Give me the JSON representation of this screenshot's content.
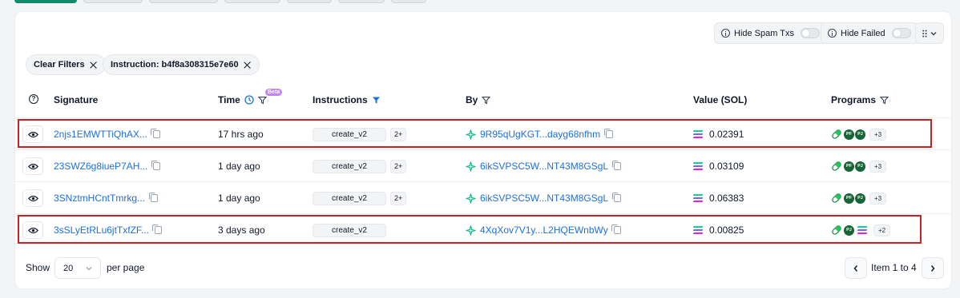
{
  "toolbar": {
    "hide_spam_label": "Hide Spam Txs",
    "hide_failed_label": "Hide Failed"
  },
  "filters": {
    "clear_label": "Clear Filters",
    "instruction_chip": "Instruction: b4f8a308315e7e60"
  },
  "table": {
    "headers": {
      "signature": "Signature",
      "time": "Time",
      "beta": "Beta",
      "instructions": "Instructions",
      "by": "By",
      "value": "Value (SOL)",
      "programs": "Programs"
    },
    "rows": [
      {
        "signature": "2njs1EMWTTiQhAX...",
        "time": "17 hrs ago",
        "instruction": "create_v2",
        "instr_more": "2+",
        "by": "9R95qUgKGT...dayg68nfhm",
        "value": "0.02391",
        "programs": [
          "PF",
          "PJ"
        ],
        "programs_more": "+3",
        "highlighted": true
      },
      {
        "signature": "23SWZ6g8iueP7AH...",
        "time": "1 day ago",
        "instruction": "create_v2",
        "instr_more": "2+",
        "by": "6ikSVPSC5W...NT43M8GSgL",
        "value": "0.03109",
        "programs": [
          "PF",
          "PJ"
        ],
        "programs_more": "+3",
        "highlighted": false
      },
      {
        "signature": "3SNztmHCntTmrkg...",
        "time": "1 day ago",
        "instruction": "create_v2",
        "instr_more": "2+",
        "by": "6ikSVPSC5W...NT43M8GSgL",
        "value": "0.06383",
        "programs": [
          "PF",
          "PJ"
        ],
        "programs_more": "+3",
        "highlighted": false
      },
      {
        "signature": "3sSLyEtRLu6jtTxfZF...",
        "time": "3 days ago",
        "instruction": "create_v2",
        "instr_more": "",
        "by": "4XqXov7V1y...L2HQEWnbWy",
        "value": "0.00825",
        "programs": [
          "PJ",
          "SOL"
        ],
        "programs_more": "+2",
        "highlighted": true
      }
    ]
  },
  "footer": {
    "show_label": "Show",
    "per_page_value": "20",
    "per_page_label": "per page",
    "page_text": "Item 1 to 4"
  },
  "colors": {
    "link": "#1d6fe0",
    "highlight": "#cc1f1f",
    "accent": "#0e8a6c"
  }
}
